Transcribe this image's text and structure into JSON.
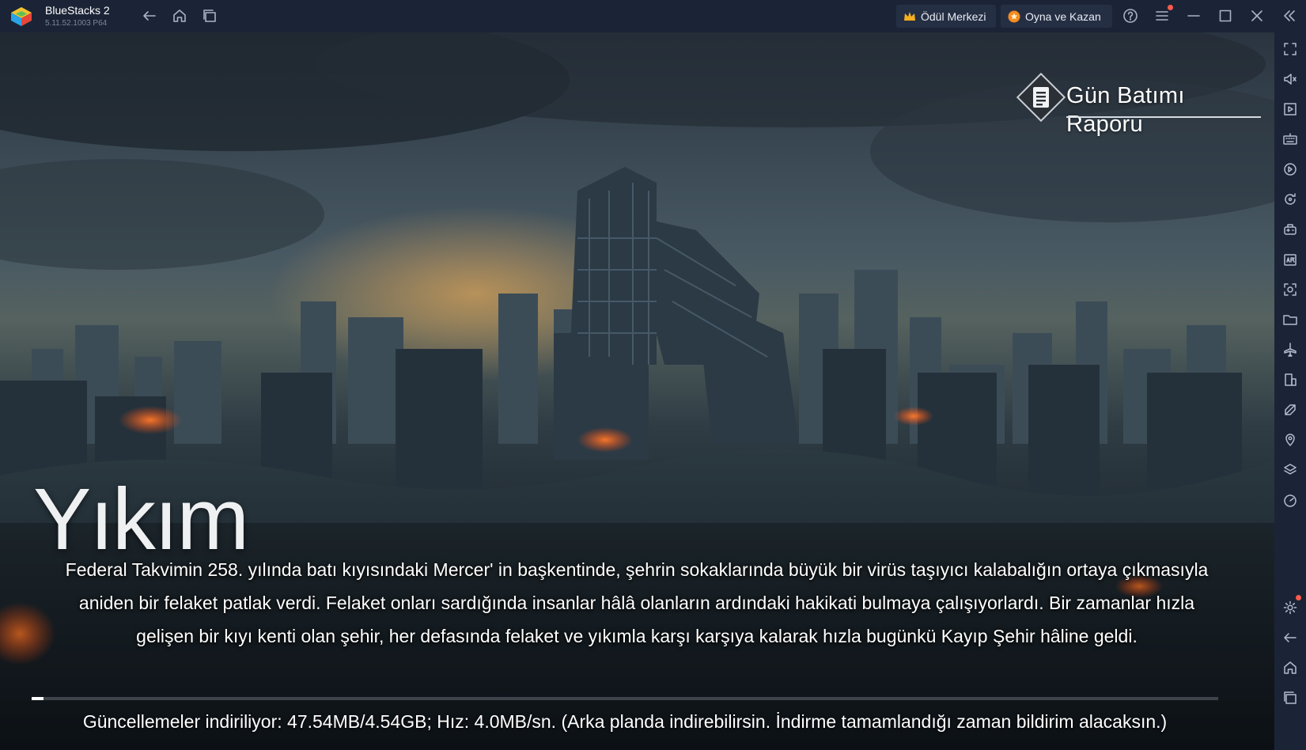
{
  "titlebar": {
    "app_name": "BlueStacks 2",
    "app_version": "5.11.52.1003  P64",
    "reward_center_label": "Ödül Merkezi",
    "play_and_win_label": "Oyna ve Kazan"
  },
  "game": {
    "report_label": "Gün Batımı Raporu",
    "chapter_title": "Yıkım",
    "story_lines": [
      "Federal Takvimin 258. yılında batı kıyısındaki Mercer' in başkentinde, şehrin sokaklarında büyük bir virüs taşıyıcı kalabalığın ortaya çıkmasıyla",
      "aniden bir felaket patlak verdi. Felaket onları sardığında insanlar hâlâ olanların ardındaki hakikati bulmaya çalışıyorlardı. Bir zamanlar hızla",
      "gelişen bir kıyı kenti olan şehir, her defasında felaket ve yıkımla karşı karşıya kalarak hızla bugünkü Kayıp Şehir hâline geldi."
    ],
    "download_status": "Güncellemeler indiriliyor: 47.54MB/4.54GB; Hız: 4.0MB/sn. (Arka planda indirebilirsin. İndirme tamamlandığı zaman bildirim alacaksın.)",
    "download_progress": 0.0102
  },
  "colors": {
    "titlebar_bg": "#1b2436",
    "sidebar_bg": "#1b2436",
    "notification": "#ff5b4d",
    "crown": "#f6b01e",
    "coin": "#f58a1f"
  },
  "icons": {
    "titlebar": [
      "back-icon",
      "home-icon",
      "multi-instance-icon",
      "help-icon",
      "menu-icon",
      "minimize-icon",
      "maximize-icon",
      "close-icon",
      "collapse-sidebar-icon"
    ],
    "sidebar": [
      "fullscreen-icon",
      "volume-icon",
      "media-icon",
      "keyboard-icon",
      "macro-icon",
      "rotate-icon",
      "gamepad-icon",
      "apk-icon",
      "screenshot-icon",
      "folder-icon",
      "airplane-icon",
      "multi-instance-icon",
      "eco-mode-icon",
      "location-icon",
      "layers-icon",
      "performance-icon",
      "settings-icon",
      "back-icon",
      "home-icon",
      "recent-apps-icon"
    ]
  }
}
